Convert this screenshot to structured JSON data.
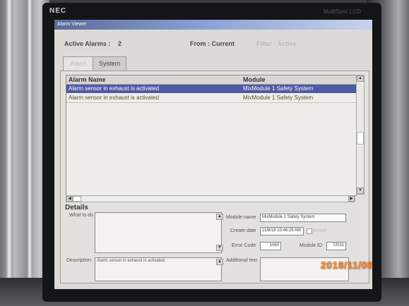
{
  "monitor": {
    "brand": "NEC",
    "model": "MultiSync LCD"
  },
  "window": {
    "title": "Alarm Viewer"
  },
  "summary": {
    "active_alarms_label": "Active Alarms :",
    "active_alarms_count": "2",
    "from_label": "From : Current",
    "filter_label": "Filter : Active"
  },
  "tabs": [
    {
      "label": "Alarm",
      "active": true
    },
    {
      "label": "System",
      "active": false
    }
  ],
  "table": {
    "columns": [
      "Alarm Name",
      "Module"
    ],
    "rows": [
      {
        "name": "Alarm sensor in exhaust is activated",
        "module": "MixModule 1 Safety System",
        "selected": true
      },
      {
        "name": "Alarm sensor in exhaust is activated",
        "module": "MixModule 1 Safety System",
        "selected": false
      }
    ]
  },
  "details": {
    "title": "Details",
    "what_to_do_label": "What to do",
    "what_to_do_value": "",
    "description_label": "Description",
    "description_value": "Alarm sensor in exhaust is activated",
    "module_name_label": "Module name",
    "module_name_value": "MixModule 1 Safety System",
    "create_date_label": "Create date",
    "create_date_value": "11/8/18 10:46:29 AM",
    "active_label": "Active",
    "error_code_label": "Error Code",
    "error_code_value": "1060",
    "module_id_label": "Module ID",
    "module_id_value": "72011",
    "additional_text_label": "Additional text",
    "additional_text_value": ""
  },
  "photo_datestamp": "2018/11/08",
  "colors": {
    "selection": "#4f5aa6",
    "titlebar": "#8fa3d6",
    "datestamp": "#f08a35"
  }
}
